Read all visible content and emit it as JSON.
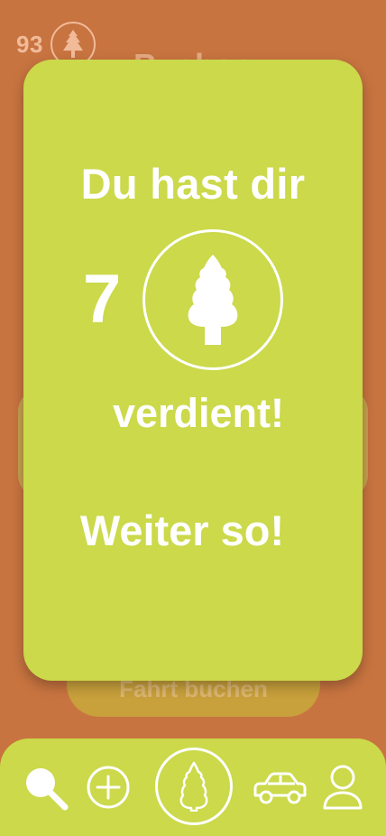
{
  "background": {
    "score": "93",
    "title": "Buchen",
    "book_button_label": "Fahrt buchen"
  },
  "modal": {
    "line1": "Du hast dir",
    "count": "7",
    "line2": "verdient!",
    "line3": "Weiter so!",
    "icon": "tree-icon"
  },
  "bottom_nav": {
    "items": [
      {
        "icon": "search-icon"
      },
      {
        "icon": "add-circle-icon"
      },
      {
        "icon": "tree-icon"
      },
      {
        "icon": "car-icon"
      },
      {
        "icon": "user-icon"
      }
    ]
  },
  "colors": {
    "background": "#c87440",
    "modal": "#cbd94a",
    "nav": "#cbd94a",
    "text": "#ffffff"
  }
}
